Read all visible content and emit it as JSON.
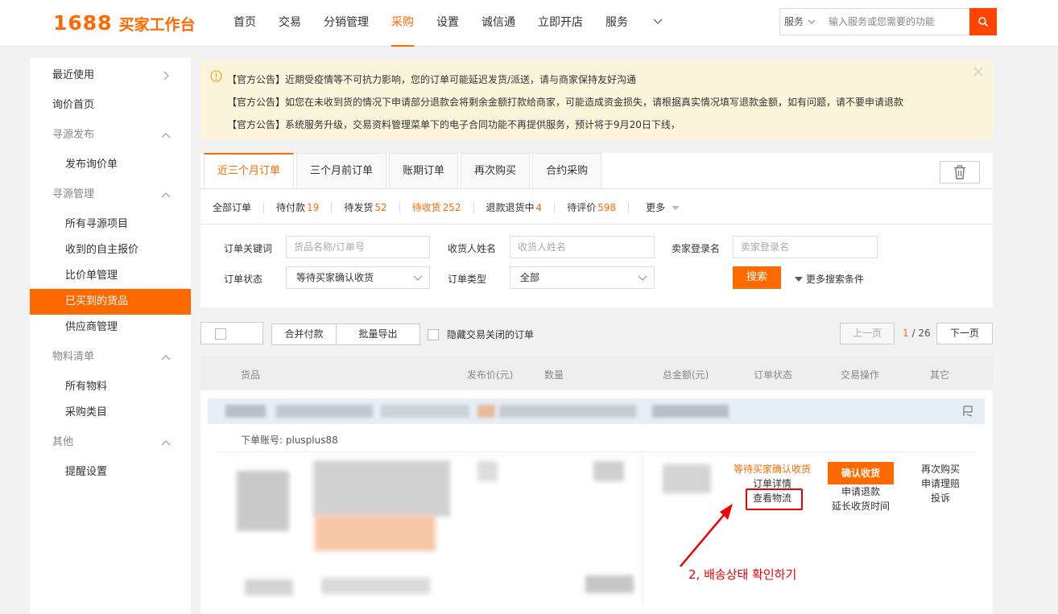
{
  "header": {
    "logo_num": "1688",
    "logo_text": "买家工作台",
    "nav": [
      "首页",
      "交易",
      "分销管理",
      "采购",
      "设置",
      "诚信通",
      "立即开店",
      "服务"
    ],
    "active_nav": "采购",
    "search": {
      "scope": "服务",
      "placeholder": "输入服务或您需要的功能"
    }
  },
  "sidebar": {
    "items": [
      {
        "label": "最近使用",
        "kind": "top",
        "chevron": "right"
      },
      {
        "label": "询价首页",
        "kind": "top"
      },
      {
        "label": "寻源发布",
        "kind": "group",
        "chevron": "up"
      },
      {
        "label": "发布询价单",
        "kind": "sub"
      },
      {
        "label": "寻源管理",
        "kind": "group",
        "chevron": "up"
      },
      {
        "label": "所有寻源项目",
        "kind": "sub"
      },
      {
        "label": "收到的自主报价",
        "kind": "sub"
      },
      {
        "label": "比价单管理",
        "kind": "sub"
      },
      {
        "label": "已买到的货品",
        "kind": "sub",
        "active": true
      },
      {
        "label": "供应商管理",
        "kind": "sub"
      },
      {
        "label": "物料清单",
        "kind": "group",
        "chevron": "up"
      },
      {
        "label": "所有物料",
        "kind": "sub"
      },
      {
        "label": "采购类目",
        "kind": "sub"
      },
      {
        "label": "其他",
        "kind": "group",
        "chevron": "up"
      },
      {
        "label": "提醒设置",
        "kind": "sub"
      }
    ]
  },
  "notice": {
    "lines": [
      "【官方公告】近期受疫情等不可抗力影响，您的订单可能延迟发货/派送，请与商家保持友好沟通",
      "【官方公告】如您在未收到货的情况下申请部分退款会将剩余金额打款给商家，可能造成资金损失，请根据真实情况填写退款金额，如有问题，请不要申请退款",
      "【官方公告】系统服务升级，交易资料管理菜单下的电子合同功能不再提供服务，预计将于9月20日下线，"
    ]
  },
  "tabs": [
    "近三个月订单",
    "三个月前订单",
    "账期订单",
    "再次购买",
    "合约采购"
  ],
  "status_filters": [
    {
      "label": "全部订单",
      "count": ""
    },
    {
      "label": "待付款",
      "count": "19"
    },
    {
      "label": "待发货",
      "count": "52"
    },
    {
      "label": "待收货",
      "count": "252",
      "active": true
    },
    {
      "label": "退款退货中",
      "count": "4"
    },
    {
      "label": "待评价",
      "count": "598"
    },
    {
      "label": "更多",
      "count": ""
    }
  ],
  "filters": {
    "keyword_label": "订单关键词",
    "keyword_placeholder": "货品名称/订单号",
    "receiver_label": "收货人姓名",
    "receiver_placeholder": "收货人姓名",
    "seller_label": "卖家登录名",
    "seller_placeholder": "卖家登录名",
    "status_label": "订单状态",
    "status_value": "等待买家确认收货",
    "type_label": "订单类型",
    "type_value": "全部",
    "search_button": "搜索",
    "more_conditions": "更多搜索条件"
  },
  "toolbar": {
    "merge_pay": "合并付款",
    "batch_export": "批量导出",
    "hide_closed": "隐藏交易关闭的订单",
    "prev": "上一页",
    "next": "下一页",
    "page_current": "1",
    "page_total": "/ 26"
  },
  "table": {
    "headers": [
      "货品",
      "发布价(元)",
      "数量",
      "总金额(元)",
      "订单状态",
      "交易操作",
      "其它"
    ]
  },
  "order": {
    "account_label": "下单账号:",
    "account": "plusplus88",
    "status_text": "等待买家确认收货",
    "detail_link": "订单详情",
    "logistics_link": "查看物流",
    "confirm_button": "确认收货",
    "refund_link": "申请退款",
    "extend_link": "延长收货时间",
    "rebuy_link": "再次购买",
    "claim_link": "申请理赔",
    "complain_link": "投诉"
  },
  "annotation": {
    "text": "2, 배송상태 확인하기",
    "color": "#e00000"
  },
  "colors": {
    "accent": "#ff6a00",
    "search_button": "#ff4400",
    "notice_bg": "#fdf4dc"
  }
}
